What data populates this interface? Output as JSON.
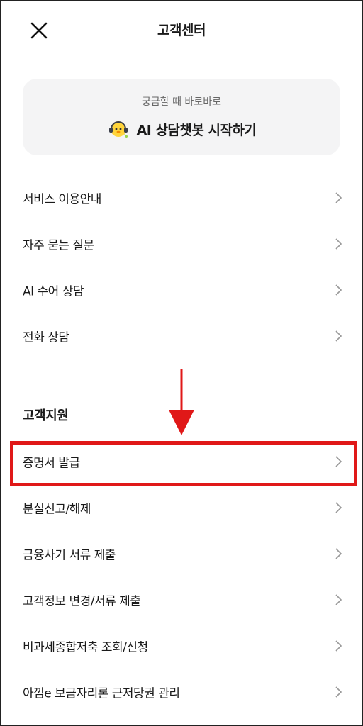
{
  "header": {
    "title": "고객센터",
    "close_icon": "close-icon"
  },
  "chatbot": {
    "subtitle": "궁금할 때 바로바로",
    "label": "AI 상담챗봇 시작하기",
    "icon": "chatbot-avatar-icon"
  },
  "menu": [
    {
      "label": "서비스 이용안내"
    },
    {
      "label": "자주 묻는 질문"
    },
    {
      "label": "AI 수어 상담"
    },
    {
      "label": "전화 상담"
    }
  ],
  "support": {
    "title": "고객지원",
    "items": [
      {
        "label": "증명서 발급"
      },
      {
        "label": "분실신고/해제"
      },
      {
        "label": "금융사기 서류 제출"
      },
      {
        "label": "고객정보 변경/서류 제출"
      },
      {
        "label": "비과세종합저축 조회/신청"
      },
      {
        "label": "아낌e 보금자리론 근저당권 관리"
      }
    ]
  },
  "colors": {
    "highlight": "#e01818",
    "card_bg": "#f4f4f5"
  }
}
